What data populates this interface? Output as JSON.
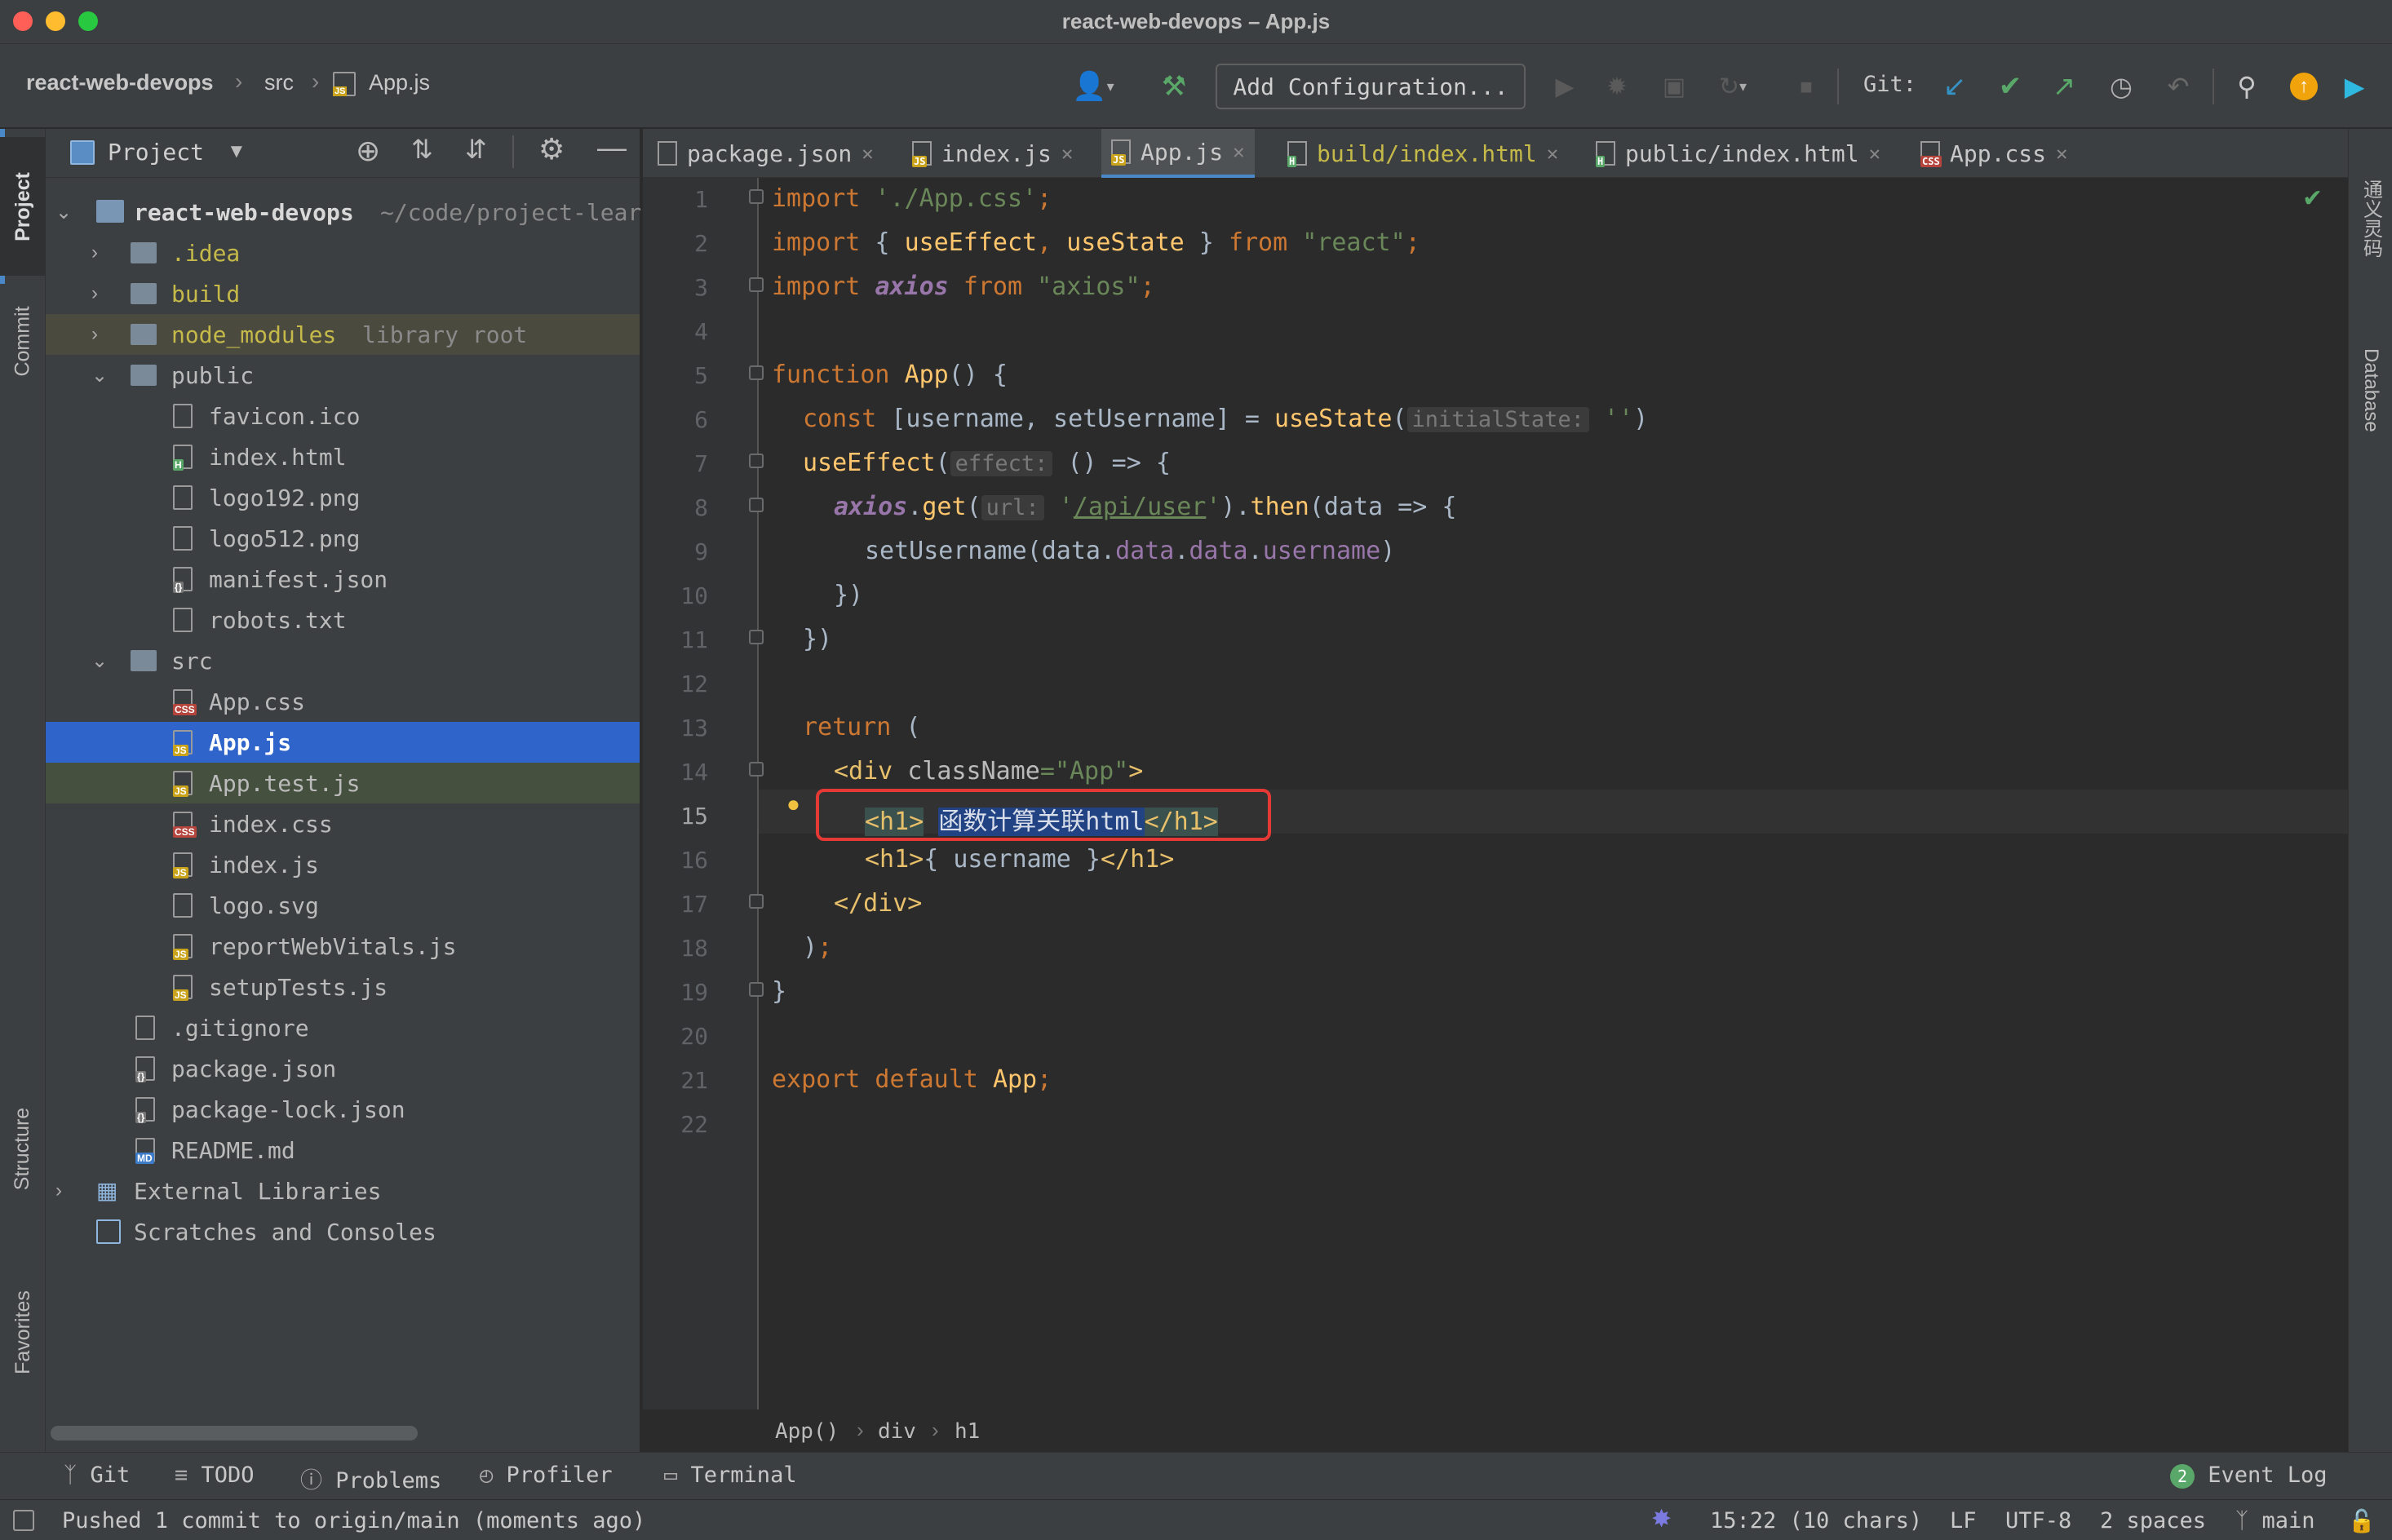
{
  "window": {
    "title": "react-web-devops – App.js"
  },
  "navbar": {
    "breadcrumb": [
      "react-web-devops",
      "src",
      "App.js"
    ],
    "add_configuration": "Add Configuration...",
    "git_label": "Git:"
  },
  "left_stripe": {
    "tabs": [
      "Project",
      "Commit",
      "Structure",
      "Favorites"
    ]
  },
  "project_panel": {
    "title": "Project",
    "tree": [
      {
        "label": "react-web-devops",
        "extra": "~/code/project-lear",
        "type": "root"
      },
      {
        "label": ".idea",
        "type": "folder"
      },
      {
        "label": "build",
        "type": "folder"
      },
      {
        "label": "node_modules",
        "extra": "library root",
        "type": "folder"
      },
      {
        "label": "public",
        "type": "folder"
      },
      {
        "label": "favicon.ico",
        "type": "file"
      },
      {
        "label": "index.html",
        "type": "file"
      },
      {
        "label": "logo192.png",
        "type": "file"
      },
      {
        "label": "logo512.png",
        "type": "file"
      },
      {
        "label": "manifest.json",
        "type": "file"
      },
      {
        "label": "robots.txt",
        "type": "file"
      },
      {
        "label": "src",
        "type": "folder"
      },
      {
        "label": "App.css",
        "type": "file"
      },
      {
        "label": "App.js",
        "type": "file",
        "selected": true
      },
      {
        "label": "App.test.js",
        "type": "file"
      },
      {
        "label": "index.css",
        "type": "file"
      },
      {
        "label": "index.js",
        "type": "file"
      },
      {
        "label": "logo.svg",
        "type": "file"
      },
      {
        "label": "reportWebVitals.js",
        "type": "file"
      },
      {
        "label": "setupTests.js",
        "type": "file"
      },
      {
        "label": ".gitignore",
        "type": "file"
      },
      {
        "label": "package.json",
        "type": "file"
      },
      {
        "label": "package-lock.json",
        "type": "file"
      },
      {
        "label": "README.md",
        "type": "file"
      },
      {
        "label": "External Libraries",
        "type": "libs"
      },
      {
        "label": "Scratches and Consoles",
        "type": "scratches"
      }
    ]
  },
  "editor": {
    "tabs": [
      {
        "label": "package.json",
        "badge": "{}",
        "color": "#c8c8c8"
      },
      {
        "label": "index.js",
        "badge": "JS",
        "color": "#c8c8c8"
      },
      {
        "label": "App.js",
        "badge": "JS",
        "color": "#c8c8c8",
        "active": true
      },
      {
        "label": "build/index.html",
        "badge": "H",
        "color": "#c5b94a"
      },
      {
        "label": "public/index.html",
        "badge": "H",
        "color": "#c8c8c8"
      },
      {
        "label": "App.css",
        "badge": "CSS",
        "color": "#c8c8c8"
      }
    ],
    "line_numbers": [
      "1",
      "2",
      "3",
      "4",
      "5",
      "6",
      "7",
      "8",
      "9",
      "10",
      "11",
      "12",
      "13",
      "14",
      "15",
      "16",
      "17",
      "18",
      "19",
      "20",
      "21",
      "22"
    ],
    "code": {
      "l1": {
        "kw": "import",
        "str": "'./App.css'",
        "end": ";"
      },
      "l2": {
        "kw": "import",
        "open": "{ ",
        "a": "useEffect",
        "sep": ", ",
        "b": "useState",
        "close": " } ",
        "from": "from",
        "str": "\"react\"",
        "end": ";"
      },
      "l3": {
        "kw": "import",
        "name": "axios",
        "from": "from",
        "str": "\"axios\"",
        "end": ";"
      },
      "l5": {
        "kw": "function",
        "name": "App",
        "rest": "() {"
      },
      "l6": {
        "kw": "const",
        "mid": " [username, setUsername] = ",
        "fn": "useState",
        "open": "(",
        "hint": "initialState:",
        "str": "''",
        "close": ")"
      },
      "l7": {
        "fn": "useEffect",
        "open": "(",
        "hint": "effect:",
        "rest": "() => {"
      },
      "l8": {
        "obj": "axios",
        "dot": ".",
        "fn": "get",
        "open": "(",
        "hint": "url:",
        "q1": "'",
        "url": "/api/user",
        "q2": "'",
        "close": ").",
        "fn2": "then",
        "rest": "(data => {"
      },
      "l9": {
        "fn": "setUsername",
        "open": "(data.",
        "p1": "data",
        "d1": ".",
        "p2": "data",
        "d2": ".",
        "p3": "username",
        "close": ")"
      },
      "l10": "})",
      "l11": "})",
      "l13": {
        "kw": "return",
        "rest": " ("
      },
      "l14": {
        "open": "<div ",
        "attr": "className",
        "eq": "=",
        "str": "\"App\"",
        "close": ">"
      },
      "l15": {
        "open": "<h1>",
        "text": "函数计算关联html",
        "close": "</h1>"
      },
      "l16": {
        "open": "<h1>",
        "text": "{ username }",
        "close": "</h1>"
      },
      "l17": {
        "tag": "</div>"
      },
      "l18": {
        "text": ")",
        "end": ";"
      },
      "l19": "}",
      "l21": {
        "kw": "export default",
        "name": "App",
        "end": ";"
      }
    },
    "breadcrumb": [
      "App()",
      "div",
      "h1"
    ]
  },
  "right_stripe": {
    "tabs": [
      "通义灵码",
      "Database"
    ]
  },
  "bottom_tools": [
    "Git",
    "TODO",
    "Problems",
    "Profiler",
    "Terminal"
  ],
  "event_log": {
    "count": "2",
    "label": "Event Log"
  },
  "status": {
    "message": "Pushed 1 commit to origin/main (moments ago)",
    "position": "15:22 (10 chars)",
    "line_sep": "LF",
    "encoding": "UTF-8",
    "indent": "2 spaces",
    "branch": "main"
  },
  "colors": {
    "accent": "#2f65ca",
    "close": "#ff5f57",
    "minimize": "#febc2e",
    "maximize": "#28c840",
    "highlight_box": "#e53935"
  }
}
